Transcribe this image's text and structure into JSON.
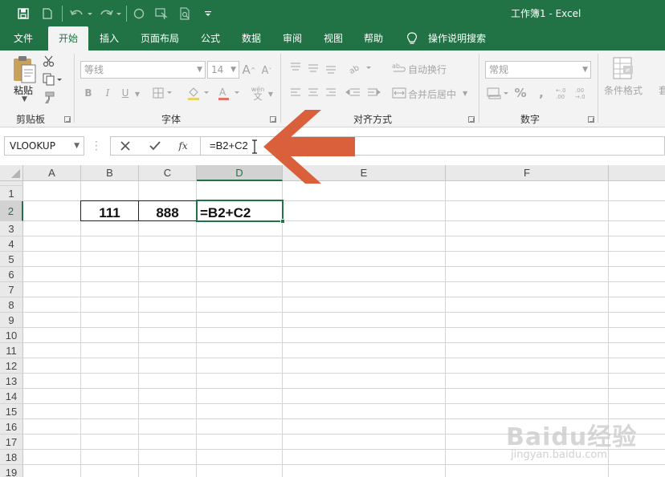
{
  "window": {
    "title": "工作簿1  -  Excel"
  },
  "ribbon_tabs": [
    "文件",
    "开始",
    "插入",
    "页面布局",
    "公式",
    "数据",
    "审阅",
    "视图",
    "帮助",
    "操作说明搜索"
  ],
  "active_tab": "开始",
  "clipboard": {
    "paste_label": "粘贴",
    "group_label": "剪贴板"
  },
  "font": {
    "font_name": "等线",
    "font_size": "14",
    "group_label": "字体",
    "phonetic": "wén"
  },
  "alignment": {
    "wrap_text": "自动换行",
    "merge_center": "合并后居中",
    "group_label": "对齐方式"
  },
  "number": {
    "format": "常规",
    "group_label": "数字"
  },
  "styles": {
    "conditional_formatting": "条件格式"
  },
  "formula_bar": {
    "name_box": "VLOOKUP",
    "formula": "=B2+C2",
    "fx": "fx"
  },
  "columns": [
    "A",
    "B",
    "C",
    "D",
    "E",
    "F"
  ],
  "rows": [
    "1",
    "2",
    "3",
    "4",
    "5",
    "6",
    "7",
    "8",
    "9",
    "10",
    "11",
    "12",
    "13",
    "14",
    "15",
    "16",
    "17",
    "18",
    "19"
  ],
  "cells": {
    "B2": "111",
    "C2": "888",
    "D2": "=B2+C2"
  },
  "selected_cell": "D2",
  "watermark": {
    "logo": "Baidu经验",
    "url": "jingyan.baidu.com"
  },
  "colors": {
    "excel_green": "#217346",
    "arrow": "#D9603B"
  }
}
